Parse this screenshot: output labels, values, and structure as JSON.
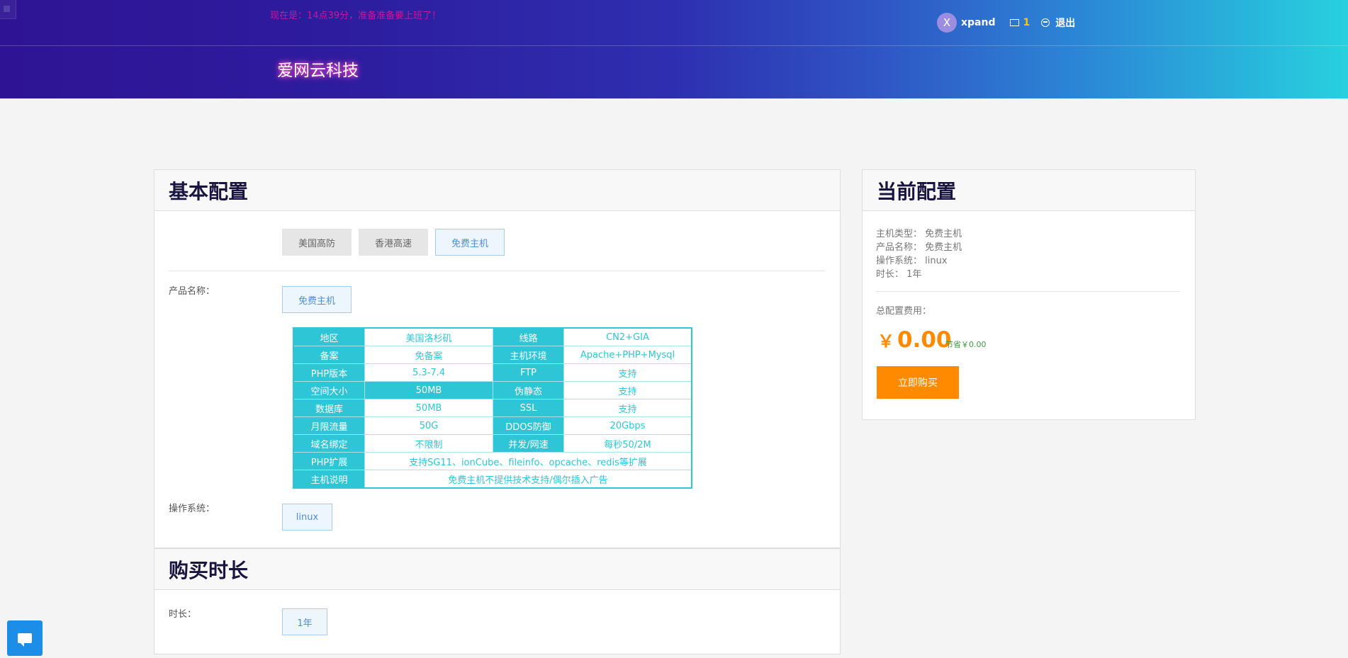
{
  "header": {
    "notice": "现在是：14点39分，准备准备要上班了！",
    "brand": "爱网云科技",
    "user": {
      "avatar_letter": "X",
      "username": "xpand",
      "message_count": "1",
      "logout": "退出"
    }
  },
  "basic": {
    "title": "基本配置",
    "type_tabs": [
      "美国高防",
      "香港高速",
      "免费主机"
    ],
    "selected_type": "免费主机",
    "product_label": "产品名称：",
    "product_option": "免费主机",
    "spec_rows": [
      [
        "地区",
        "美国洛杉矶",
        "线路",
        "CN2+GIA"
      ],
      [
        "备案",
        "免备案",
        "主机环境",
        "Apache+PHP+Mysql"
      ],
      [
        "PHP版本",
        "5.3-7.4",
        "FTP",
        "支持"
      ],
      [
        "空间大小",
        "50MB",
        "伪静态",
        "支持"
      ],
      [
        "数据库",
        "50MB",
        "SSL",
        "支持"
      ],
      [
        "月限流量",
        "50G",
        "DDOS防御",
        "20Gbps"
      ],
      [
        "域名绑定",
        "不限制",
        "并发/网速",
        "每秒50/2M"
      ]
    ],
    "spec_wide_rows": [
      [
        "PHP扩展",
        "支持SG11、ionCube、fileinfo、opcache、redis等扩展"
      ],
      [
        "主机说明",
        "免费主机不提供技术支持/偶尔插入广告"
      ]
    ],
    "os_label": "操作系统：",
    "os_option": "linux"
  },
  "duration": {
    "title": "购买时长",
    "label": "时长：",
    "option": "1年"
  },
  "summary": {
    "title": "当前配置",
    "lines": [
      "主机类型： 免费主机",
      "产品名称： 免费主机",
      "操作系统： linux",
      "时长： 1年"
    ],
    "total_label": "总配置费用：",
    "currency": "￥",
    "price": "0.00",
    "saving": "节省￥0.00",
    "buy": "立即购买"
  },
  "colors": {
    "accent": "#2ec6d6",
    "orange": "#ff8a00",
    "header_start": "#2e1494",
    "header_end": "#27d1de"
  },
  "icons": {
    "mail": "mail-icon",
    "logout": "logout-icon",
    "chat": "chat-icon"
  }
}
